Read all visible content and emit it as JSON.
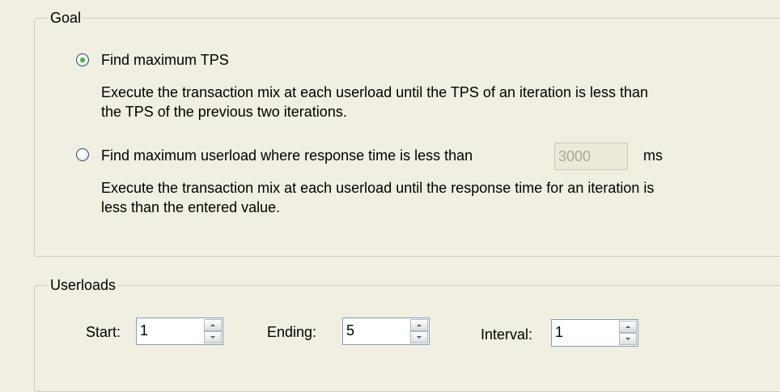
{
  "goal": {
    "title": "Goal",
    "option_max_tps": {
      "label": "Find maximum TPS",
      "selected": true,
      "description_line1": "Execute the transaction mix at each userload until the TPS of an iteration is less than",
      "description_line2": "the TPS of the previous two iterations."
    },
    "option_max_userload": {
      "label": "Find maximum userload where response time is less than",
      "selected": false,
      "response_time_value": "3000",
      "unit": "ms",
      "description_line1": "Execute the transaction mix at each userload until the response time for an iteration is",
      "description_line2": "less than the entered value."
    }
  },
  "userloads": {
    "title": "Userloads",
    "start": {
      "label": "Start:",
      "value": "1"
    },
    "ending": {
      "label": "Ending:",
      "value": "5"
    },
    "interval": {
      "label": "Interval:",
      "value": "1"
    }
  },
  "colors": {
    "background": "#f1efe2",
    "groupbox_border": "#d0d0bf",
    "radio_dot": "#21a121",
    "field_border": "#7f9db9"
  }
}
